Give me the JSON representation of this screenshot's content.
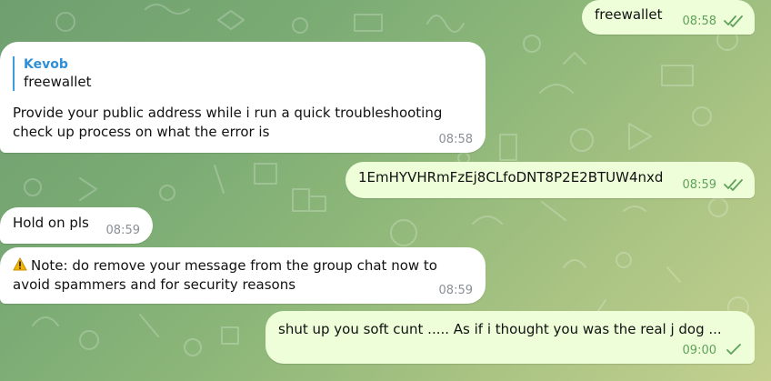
{
  "messages": [
    {
      "id": "m1",
      "direction": "outgoing",
      "text": "freewallet",
      "time": "08:58",
      "ticks": "double"
    },
    {
      "id": "m2",
      "direction": "incoming",
      "reply_to": {
        "author": "Kevob",
        "text": "freewallet"
      },
      "text": "Provide your public address while i run a quick troubleshooting check up process on what the error is",
      "time": "08:58"
    },
    {
      "id": "m3",
      "direction": "outgoing",
      "text": "1EmHYVHRmFzEj8CLfoDNT8P2E2BTUW4nxd",
      "time": "08:59",
      "ticks": "double"
    },
    {
      "id": "m4",
      "direction": "incoming",
      "text": "Hold on pls",
      "time": "08:59"
    },
    {
      "id": "m5",
      "direction": "incoming",
      "icon": "warning-icon",
      "text": "Note: do remove your message from the group chat now to avoid spammers and for security reasons",
      "time": "08:59"
    },
    {
      "id": "m6",
      "direction": "outgoing",
      "text": "shut up you soft cunt ..... As if i thought you was the real j dog ...",
      "time": "09:00",
      "ticks": "single"
    }
  ]
}
